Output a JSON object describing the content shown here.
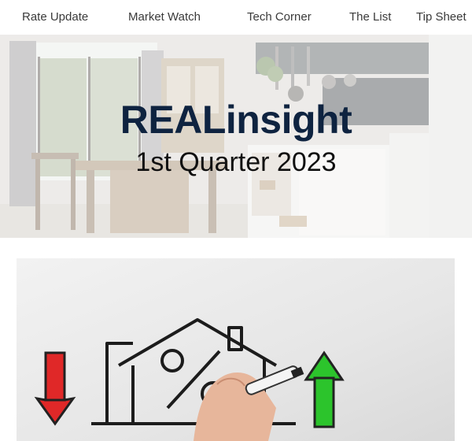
{
  "nav": {
    "items": [
      {
        "label": "Rate Update"
      },
      {
        "label": "Market Watch"
      },
      {
        "label": "Tech Corner"
      },
      {
        "label": "The List"
      },
      {
        "label": "Tip Sheet"
      }
    ]
  },
  "hero": {
    "brand": "REALinsight",
    "subtitle": "1st Quarter 2023"
  },
  "colors": {
    "brand_text": "#0e2340",
    "down_arrow": "#e02828",
    "up_arrow": "#2cc42c"
  }
}
